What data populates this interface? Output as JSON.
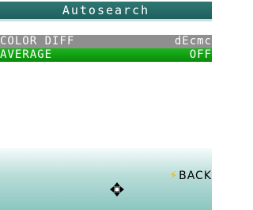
{
  "header": {
    "title": "Autosearch"
  },
  "list": {
    "items": [
      {
        "label": "COLOR DIFF",
        "value": "dEcmc"
      },
      {
        "label": "AVERAGE",
        "value": "OFF"
      }
    ]
  },
  "softkeys": {
    "right_icon": "lightning-icon",
    "right_label": "BACK"
  },
  "nav": {
    "icon": "dpad-icon"
  },
  "colors": {
    "title_bar": "#1f5f5c",
    "row_inactive": "#8f8f8f",
    "row_selected": "#0b8a0b",
    "softkey_area": "#8cc6c0"
  }
}
